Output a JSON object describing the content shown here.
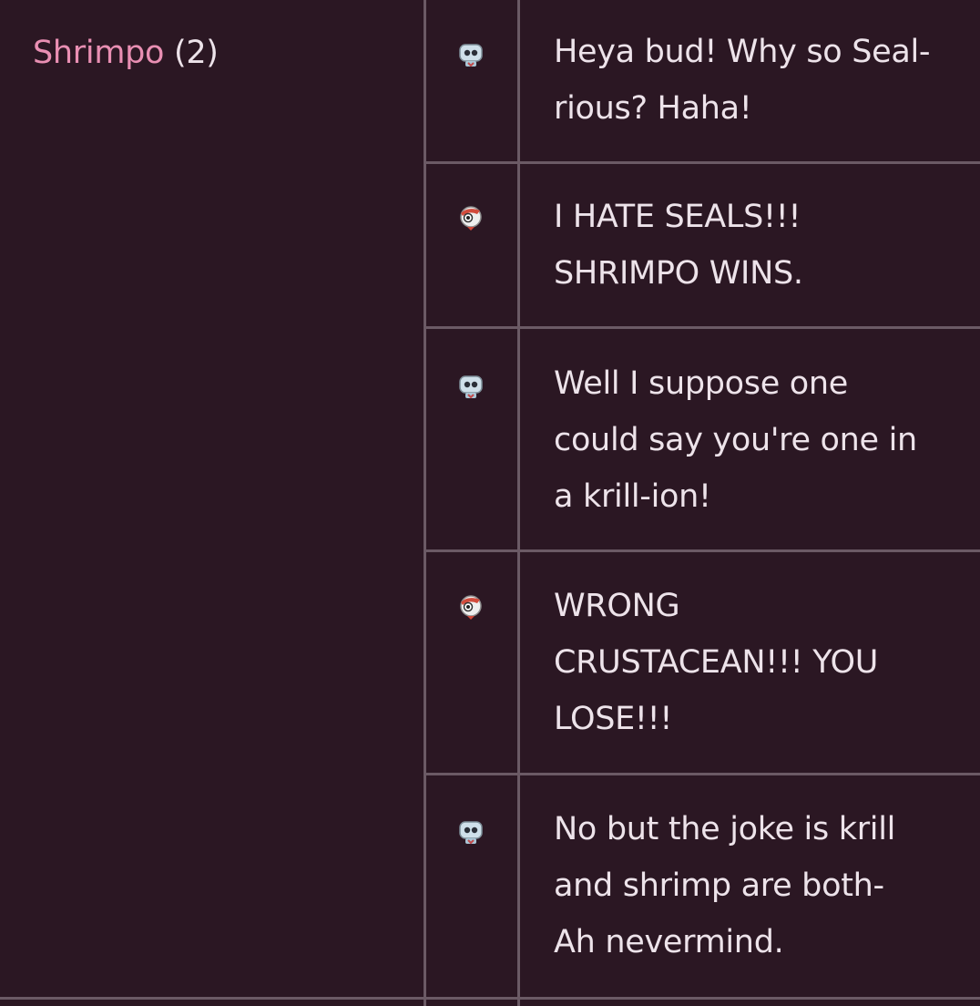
{
  "character": {
    "name": "Shrimpo",
    "count": "(2)"
  },
  "dialogue": [
    {
      "speaker_icon": "dandy-icon",
      "lines": "Heya bud! Why so Seal-\nrious? Haha!"
    },
    {
      "speaker_icon": "shrimpo-icon",
      "lines": "I HATE SEALS!!!\nSHRIMPO WINS."
    },
    {
      "speaker_icon": "dandy-icon",
      "lines": "Well I suppose one\ncould say you're one in\na krill-ion!"
    },
    {
      "speaker_icon": "shrimpo-icon",
      "lines": "WRONG\nCRUSTACEAN!!! YOU\nLOSE!!!"
    },
    {
      "speaker_icon": "dandy-icon",
      "lines": "No but the joke is krill\nand shrimp are both-\nAh nevermind."
    }
  ],
  "colors": {
    "background": "#2b1723",
    "border": "#6b5a65",
    "name_accent": "#e98fb3",
    "text": "#ede3ea"
  }
}
